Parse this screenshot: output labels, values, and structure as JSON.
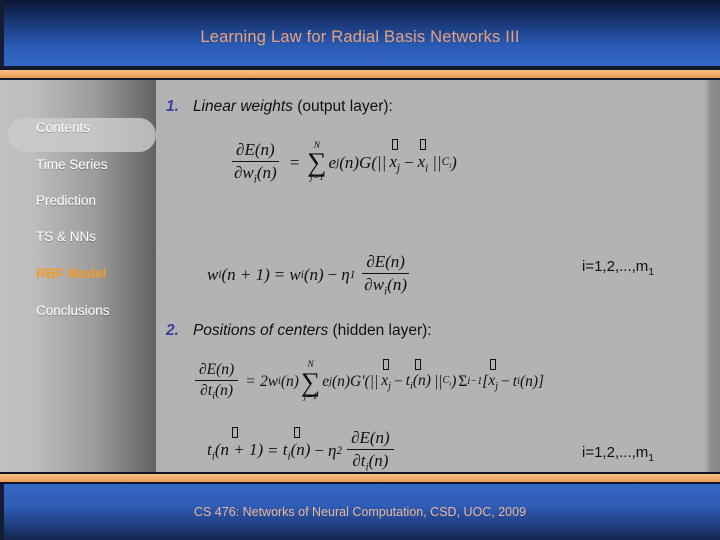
{
  "header": {
    "title": "Learning Law for Radial Basis Networks III",
    "title_color": "#e8a27a",
    "band_color": "#2a5bb5",
    "rule_color": "#f2ae6d"
  },
  "sidebar": {
    "items": [
      {
        "label": "Contents",
        "active": false
      },
      {
        "label": "Time Series",
        "active": false
      },
      {
        "label": "Prediction",
        "active": false
      },
      {
        "label": "TS & NNs",
        "active": false
      },
      {
        "label": "RBF Model",
        "active": true
      },
      {
        "label": "Conclusions",
        "active": false
      }
    ],
    "active_color": "#f59a22",
    "inactive_color": "#ffffff"
  },
  "content": {
    "bullets": [
      {
        "number": "1.",
        "emphasis": "Linear weights",
        "rest": "(output layer):"
      },
      {
        "number": "2.",
        "emphasis": "Positions of centers",
        "rest": "(hidden layer):"
      }
    ],
    "number_color": "#3a3fa0",
    "index_labels": [
      "i=1,2,...,m1",
      "i=1,2,...,m1"
    ],
    "equations": [
      {
        "id": "eq1",
        "latex": "\\frac{\\partial E(n)}{\\partial w_i(n)} = \\sum_{j=1}^{N} e_j(n) G(\\| \\vec{x}_j - \\vec{x}_i \\|_{C_i})",
        "parts": {
          "num": "∂E(n)",
          "den": "∂w",
          "den_sub": "i",
          "den_tail": "(n)",
          "equals": "=",
          "sum_top": "N",
          "sum_bot": "j=1",
          "body_e": "e",
          "body_e_sub": "j",
          "body_mid": "(n)G(||",
          "vec1": "x",
          "vec1_sub": "j",
          "minus": "−",
          "vec2": "x",
          "vec2_sub": "i",
          "norm": "||",
          "norm_sub": "C",
          "norm_sub2": "i",
          "close": ")"
        }
      },
      {
        "id": "eq2",
        "latex": "w_i(n+1) = w_i(n) - \\eta_1 \\frac{\\partial E(n)}{\\partial w_i(n)}",
        "parts": {
          "lhs_w": "w",
          "lhs_sub": "i",
          "lhs_tail": "(n + 1)",
          "equals": "=",
          "rhs_w": "w",
          "rhs_sub": "i",
          "rhs_tail": "(n)",
          "minus": "−",
          "eta": "η",
          "eta_sub": "1",
          "num": "∂E(n)",
          "den": "∂w",
          "den_sub": "i",
          "den_tail": "(n)"
        }
      },
      {
        "id": "eq3",
        "latex": "\\frac{\\partial E(n)}{\\partial t_i(n)} = 2 w_i(n) \\sum_{j=1}^{N} e_j(n) G'(\\| \\vec{x}_j - t_i(n) \\|_{C_i}) \\Sigma_i^{-1} [\\vec{x}_j - t_i(n)]",
        "parts": {
          "num": "∂E(n)",
          "den": "∂t",
          "den_sub": "i",
          "den_tail": "(n)",
          "equals": "=",
          "two_w": "2w",
          "two_w_sub": "i",
          "two_w_tail": "(n)",
          "sum_top": "N",
          "sum_bot": "j=1",
          "body_e": "e",
          "body_e_sub": "j",
          "body_mid": "(n)G'(||",
          "vec1": "x",
          "vec1_sub": "j",
          "minus": "−",
          "t_sym": "t",
          "t_sub": "i",
          "t_tail": "(n)",
          "norm": "||",
          "norm_sub": "C",
          "norm_sub2": "i",
          "close": ")",
          "sigma_cap": "Σ",
          "sigma_sub": "i",
          "sigma_sup": "−1",
          "brk_open": "[",
          "vec3": "x",
          "vec3_sub": "j",
          "minus2": "−",
          "t2_sym": "t",
          "t2_sub": "i",
          "t2_tail": "(n)",
          "brk_close": "]"
        }
      },
      {
        "id": "eq4",
        "latex": "\\vec{t}_i(n+1) = \\vec{t}_i(n) - \\eta_2 \\frac{\\partial E(n)}{\\partial t_i(n)}",
        "parts": {
          "lhs_t": "t",
          "lhs_sub": "i",
          "lhs_tail": "(n + 1)",
          "equals": "=",
          "rhs_t": "t",
          "rhs_sub": "i",
          "rhs_tail": "(n)",
          "minus": "−",
          "eta": "η",
          "eta_sub": "2",
          "num": "∂E(n)",
          "den": "∂t",
          "den_sub": "i",
          "den_tail": "(n)"
        }
      }
    ]
  },
  "footer": {
    "text": "CS 476: Networks of Neural Computation, CSD, UOC, 2009",
    "text_color": "#e8b79a",
    "band_color": "#2f5cb4"
  }
}
